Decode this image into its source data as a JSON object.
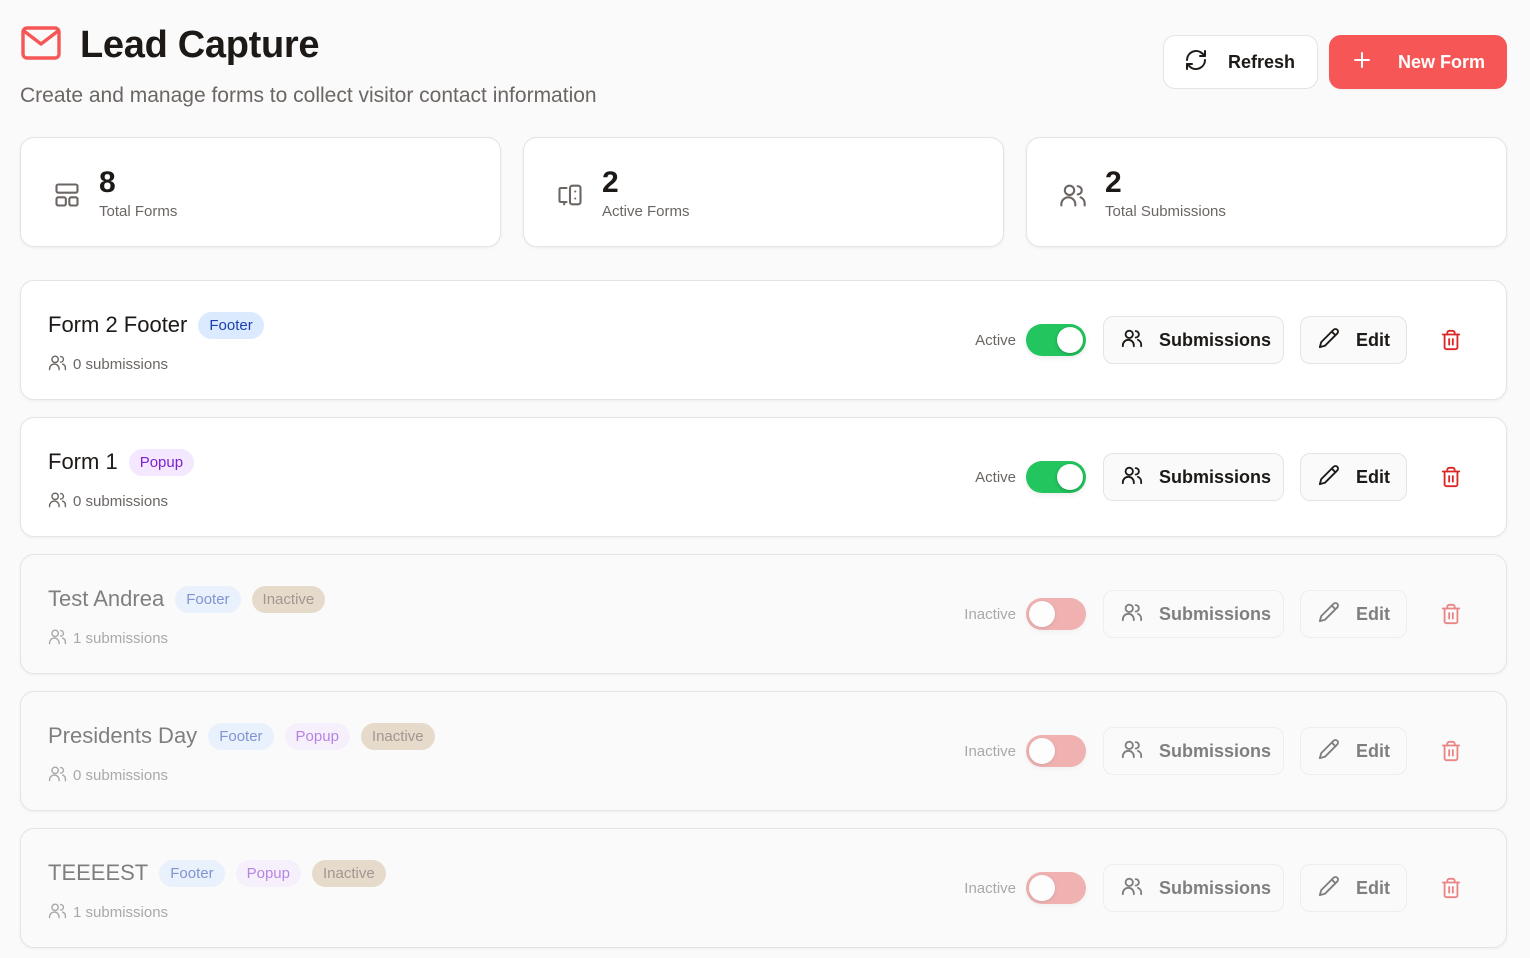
{
  "header": {
    "title": "Lead Capture",
    "subtitle": "Create and manage forms to collect visitor contact information",
    "refresh_label": "Refresh",
    "new_form_label": "New Form",
    "brand_color": "#f65656"
  },
  "stats": [
    {
      "value": "8",
      "label": "Total Forms",
      "icon": "layout-icon"
    },
    {
      "value": "2",
      "label": "Active Forms",
      "icon": "devices-icon"
    },
    {
      "value": "2",
      "label": "Total Submissions",
      "icon": "users-icon"
    }
  ],
  "forms": [
    {
      "name": "Form 2 Footer",
      "badges": [
        "Footer"
      ],
      "submissions": "0 submissions",
      "status": "Active",
      "active": true
    },
    {
      "name": "Form 1",
      "badges": [
        "Popup"
      ],
      "submissions": "0 submissions",
      "status": "Active",
      "active": true
    },
    {
      "name": "Test Andrea",
      "badges": [
        "Footer",
        "Inactive"
      ],
      "submissions": "1 submissions",
      "status": "Inactive",
      "active": false
    },
    {
      "name": "Presidents Day",
      "badges": [
        "Footer",
        "Popup",
        "Inactive"
      ],
      "submissions": "0 submissions",
      "status": "Inactive",
      "active": false
    },
    {
      "name": "TEEEEST",
      "badges": [
        "Footer",
        "Popup",
        "Inactive"
      ],
      "submissions": "1 submissions",
      "status": "Inactive",
      "active": false
    }
  ],
  "actions": {
    "submissions_label": "Submissions",
    "edit_label": "Edit"
  },
  "colors": {
    "active_toggle": "#22c55e",
    "inactive_toggle": "#e87575",
    "delete": "#dc2626"
  }
}
